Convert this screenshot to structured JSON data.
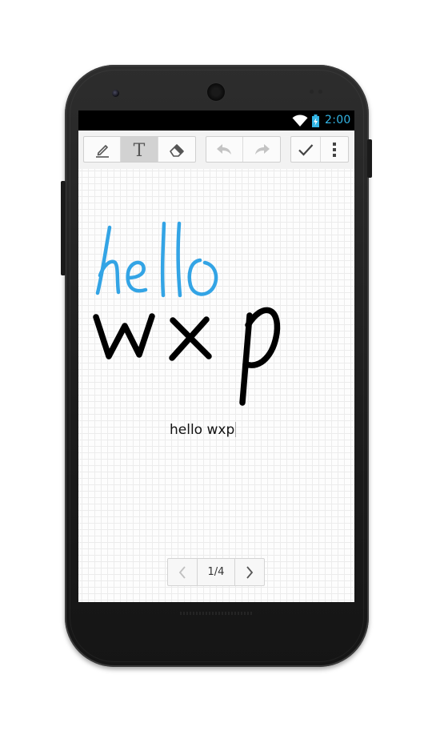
{
  "status_bar": {
    "time": "2:00",
    "time_color": "#33b5e5",
    "icons": [
      "wifi-icon",
      "battery-charging-icon"
    ]
  },
  "toolbar": {
    "tools": [
      {
        "name": "pen-icon",
        "selected": false
      },
      {
        "name": "text-icon",
        "label": "T",
        "selected": true
      },
      {
        "name": "eraser-icon",
        "selected": false
      }
    ],
    "history": [
      "undo-icon",
      "redo-icon"
    ],
    "actions": [
      "checkmark-icon",
      "overflow-menu-icon"
    ]
  },
  "canvas": {
    "handwriting": [
      {
        "text": "hello",
        "color": "#33a4e5"
      },
      {
        "text": "wxp",
        "color": "#000000"
      }
    ],
    "typed_text": "hello wxp"
  },
  "pager": {
    "label": "1/4",
    "icons": [
      "chevron-left-icon",
      "chevron-right-icon"
    ]
  }
}
